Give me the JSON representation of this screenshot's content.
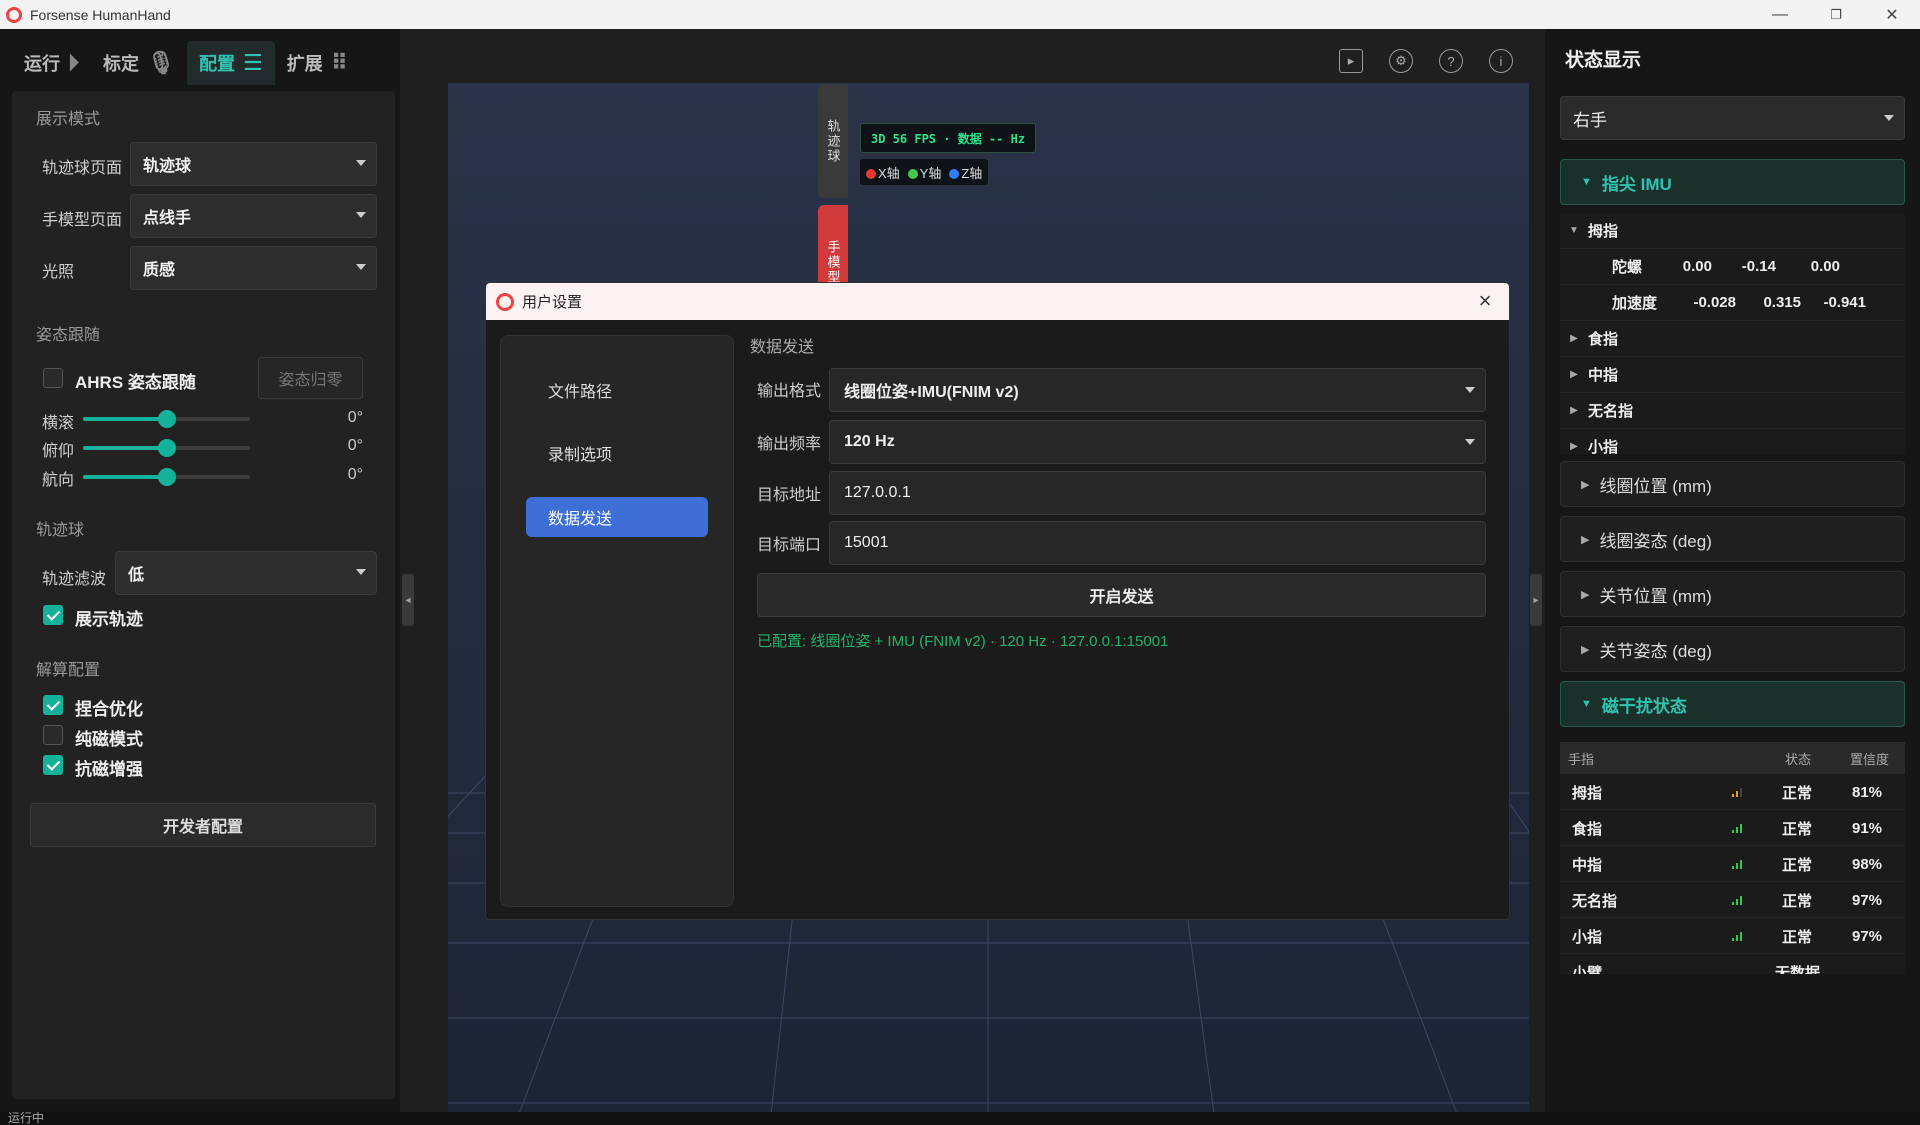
{
  "window": {
    "title": "Forsense HumanHand",
    "minimize": "—",
    "restore": "❐",
    "close": "✕"
  },
  "tabs": [
    {
      "label": "运行",
      "icon": "play-icon"
    },
    {
      "label": "标定",
      "icon": "mic-icon"
    },
    {
      "label": "配置",
      "icon": "sliders-icon"
    },
    {
      "label": "扩展",
      "icon": "apps-grid-icon"
    }
  ],
  "left": {
    "display_mode": {
      "section": "展示模式",
      "trackball_page_label": "轨迹球页面",
      "trackball_page_value": "轨迹球",
      "hand_model_page_label": "手模型页面",
      "hand_model_page_value": "点线手",
      "lighting_label": "光照",
      "lighting_value": "质感"
    },
    "pose_follow": {
      "section": "姿态跟随",
      "ahrs_label": "AHRS 姿态跟随",
      "ahrs_checked": false,
      "reset_button": "姿态归零",
      "sliders": [
        {
          "label": "横滚",
          "value": "0°",
          "fraction": 0.5
        },
        {
          "label": "俯仰",
          "value": "0°",
          "fraction": 0.5
        },
        {
          "label": "航向",
          "value": "0°",
          "fraction": 0.5
        }
      ]
    },
    "trackball": {
      "section": "轨迹球",
      "filter_label": "轨迹滤波",
      "filter_value": "低",
      "show_trail_label": "展示轨迹",
      "show_trail_checked": true
    },
    "solver": {
      "section": "解算配置",
      "options": [
        {
          "label": "捏合优化",
          "checked": true
        },
        {
          "label": "纯磁模式",
          "checked": false
        },
        {
          "label": "抗磁增强",
          "checked": true
        }
      ],
      "dev_button": "开发者配置"
    }
  },
  "center": {
    "toolbar_icons": [
      "screen-record-icon",
      "settings-icon",
      "help-icon",
      "info-icon"
    ],
    "side_tabs": [
      {
        "label": "轨迹球"
      },
      {
        "label": "手模型"
      }
    ],
    "hud": "3D 56 FPS · 数据 -- Hz",
    "axes": [
      {
        "label": "X轴",
        "color": "#e53935"
      },
      {
        "label": "Y轴",
        "color": "#43c84a"
      },
      {
        "label": "Z轴",
        "color": "#2f7cf6"
      }
    ]
  },
  "dialog": {
    "title": "用户设置",
    "nav": [
      {
        "label": "文件路径",
        "active": false
      },
      {
        "label": "录制选项",
        "active": false
      },
      {
        "label": "数据发送",
        "active": true
      }
    ],
    "section": "数据发送",
    "fields": {
      "format_label": "输出格式",
      "format_value": "线圈位姿+IMU(FNIM v2)",
      "rate_label": "输出频率",
      "rate_value": "120 Hz",
      "address_label": "目标地址",
      "address_value": "127.0.0.1",
      "port_label": "目标端口",
      "port_value": "15001"
    },
    "start_button": "开启发送",
    "status": "已配置: 线圈位姿 + IMU (FNIM v2) · 120 Hz · 127.0.0.1:15001"
  },
  "right": {
    "title": "状态显示",
    "hand_select": "右手",
    "imu_section": "指尖 IMU",
    "tree": {
      "thumb": "拇指",
      "gyro_label": "陀螺",
      "gyro": [
        "0.00",
        "-0.14",
        "0.00"
      ],
      "accel_label": "加速度",
      "accel": [
        "-0.028",
        "0.315",
        "-0.941"
      ],
      "fingers": [
        "食指",
        "中指",
        "无名指",
        "小指"
      ]
    },
    "sections": [
      "线圈位置 (mm)",
      "线圈姿态 (deg)",
      "关节位置 (mm)",
      "关节姿态 (deg)"
    ],
    "mag_section": "磁干扰状态",
    "mag_table": {
      "headers": [
        "手指",
        "状态",
        "置信度"
      ],
      "rows": [
        {
          "finger": "拇指",
          "status": "正常",
          "confidence": "81%",
          "bar_color": "#e0a020",
          "level": 2
        },
        {
          "finger": "食指",
          "status": "正常",
          "confidence": "91%",
          "bar_color": "#2ecc40",
          "level": 3
        },
        {
          "finger": "中指",
          "status": "正常",
          "confidence": "98%",
          "bar_color": "#2ecc40",
          "level": 3
        },
        {
          "finger": "无名指",
          "status": "正常",
          "confidence": "97%",
          "bar_color": "#2ecc40",
          "level": 3
        },
        {
          "finger": "小指",
          "status": "正常",
          "confidence": "97%",
          "bar_color": "#2ecc40",
          "level": 3
        },
        {
          "finger": "小臂",
          "status": "无数据",
          "confidence": "",
          "bar_color": "#666",
          "level": 0
        }
      ]
    }
  },
  "statusbar": "运行中"
}
